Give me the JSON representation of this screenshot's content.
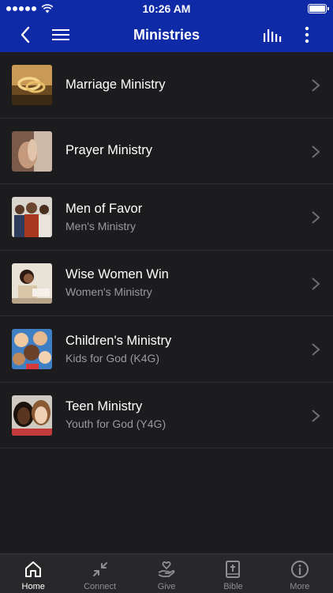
{
  "status_bar": {
    "time": "10:26 AM"
  },
  "nav": {
    "title": "Ministries"
  },
  "ministries": [
    {
      "title": "Marriage Ministry",
      "subtitle": ""
    },
    {
      "title": "Prayer Ministry",
      "subtitle": ""
    },
    {
      "title": "Men of Favor",
      "subtitle": "Men's Ministry"
    },
    {
      "title": "Wise Women Win",
      "subtitle": "Women's Ministry"
    },
    {
      "title": "Children's Ministry",
      "subtitle": "Kids for God (K4G)"
    },
    {
      "title": "Teen Ministry",
      "subtitle": "Youth for God (Y4G)"
    }
  ],
  "tabs": [
    {
      "label": "Home",
      "icon": "home-icon",
      "active": true
    },
    {
      "label": "Connect",
      "icon": "connect-icon",
      "active": false
    },
    {
      "label": "Give",
      "icon": "give-icon",
      "active": false
    },
    {
      "label": "Bible",
      "icon": "bible-icon",
      "active": false
    },
    {
      "label": "More",
      "icon": "info-icon",
      "active": false
    }
  ],
  "colors": {
    "header": "#0f2aa6",
    "background": "#1c1c1e",
    "tab_bar": "#28282a"
  }
}
